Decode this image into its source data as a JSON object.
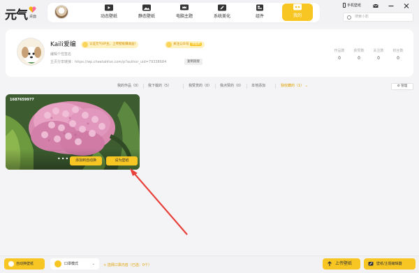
{
  "app": {
    "logo_text": "元气",
    "logo_sub": "桌面"
  },
  "nav": {
    "items": [
      {
        "label": "动态壁纸",
        "icon": "play-film-icon"
      },
      {
        "label": "静态壁纸",
        "icon": "picture-icon"
      },
      {
        "label": "电脑主题",
        "icon": "crown-monitor-icon"
      },
      {
        "label": "系统美化",
        "icon": "brush-icon"
      },
      {
        "label": "组件",
        "icon": "widget-icon"
      },
      {
        "label": "我的",
        "icon": "eyes-icon",
        "active": true
      }
    ]
  },
  "topright": {
    "phone_label": "手机壁纸",
    "search_placeholder": "搜索小影"
  },
  "profile": {
    "name": "Kaili爱编",
    "badge_certify": "认证元气UP主，上传壁纸赚收益!",
    "badge_follow_pre": "关注公众号",
    "badge_follow_highlight": "领福利",
    "desc": "编辑个性签名",
    "link_label": "主页分享链接：",
    "link_url": "https://wp.cheetahfun.com/p?author_uid=79338684",
    "copy_label": "复制链接",
    "stats": [
      {
        "label": "作品数",
        "value": "0"
      },
      {
        "label": "获赞数",
        "value": "0"
      },
      {
        "label": "关注数",
        "value": "0"
      },
      {
        "label": "粉丝数",
        "value": "0"
      }
    ]
  },
  "tabs": {
    "items": [
      {
        "label": "我的作品（0）"
      },
      {
        "label": "我下载的（5）"
      },
      {
        "label": "我赞赏的（0）"
      },
      {
        "label": "我点赞的（0）"
      },
      {
        "label": "本地添加"
      },
      {
        "label": "我收藏的（1）",
        "active": true
      }
    ],
    "manage_label": "管理"
  },
  "wallpapers": [
    {
      "id": "1687659977",
      "add_label": "添加到自动换",
      "set_label": "设为壁纸",
      "more_label": "•••"
    }
  ],
  "bottom": {
    "auto_label": "自动换壁纸",
    "mode_label": "口罩模式",
    "pick_hint": "+ 选择口罩内容（已选：0个）",
    "upload_label": "上传壁纸",
    "editor_label": "壁纸/主题编辑器"
  },
  "colors": {
    "accent": "#f7c623",
    "accent_text": "#e0a000",
    "annotation_arrow": "#e8413c"
  }
}
